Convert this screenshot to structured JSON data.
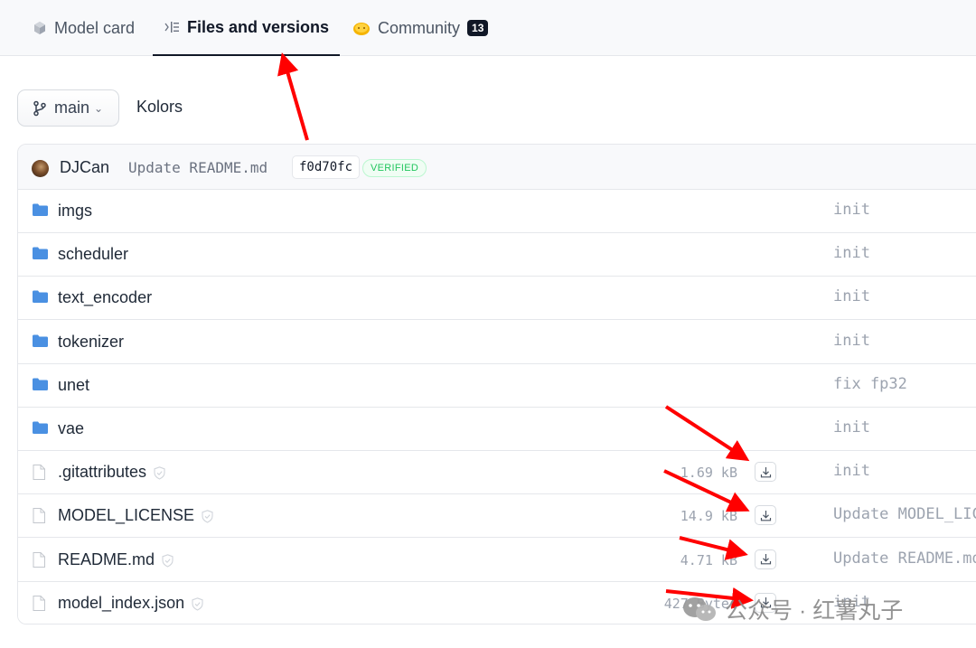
{
  "tabs": [
    {
      "label": "Model card",
      "icon": "cube-icon",
      "active": false
    },
    {
      "label": "Files and versions",
      "icon": "files-icon",
      "active": true
    },
    {
      "label": "Community",
      "icon": "community-icon",
      "active": false,
      "badge": "13"
    }
  ],
  "branch": {
    "label": "main"
  },
  "repo": {
    "name": "Kolors"
  },
  "commit": {
    "author": "DJCan",
    "message": "Update README.md",
    "hash": "f0d70fc",
    "verified": "VERIFIED"
  },
  "files": [
    {
      "name": "imgs",
      "type": "folder",
      "commit": "init"
    },
    {
      "name": "scheduler",
      "type": "folder",
      "commit": "init"
    },
    {
      "name": "text_encoder",
      "type": "folder",
      "commit": "init"
    },
    {
      "name": "tokenizer",
      "type": "folder",
      "commit": "init"
    },
    {
      "name": "unet",
      "type": "folder",
      "commit": "fix fp32"
    },
    {
      "name": "vae",
      "type": "folder",
      "commit": "init"
    },
    {
      "name": ".gitattributes",
      "type": "file",
      "size": "1.69 kB",
      "commit": "init"
    },
    {
      "name": "MODEL_LICENSE",
      "type": "file",
      "size": "14.9 kB",
      "commit": "Update MODEL_LIC"
    },
    {
      "name": "README.md",
      "type": "file",
      "size": "4.71 kB",
      "commit": "Update README.md"
    },
    {
      "name": "model_index.json",
      "type": "file",
      "size": "427 Bytes",
      "commit": "init"
    }
  ],
  "watermark": {
    "text": "公众号 · 红薯丸子"
  },
  "colors": {
    "annotation_arrow": "#ff0000",
    "folder": "#4a90e2",
    "verified": "#22c55e"
  }
}
